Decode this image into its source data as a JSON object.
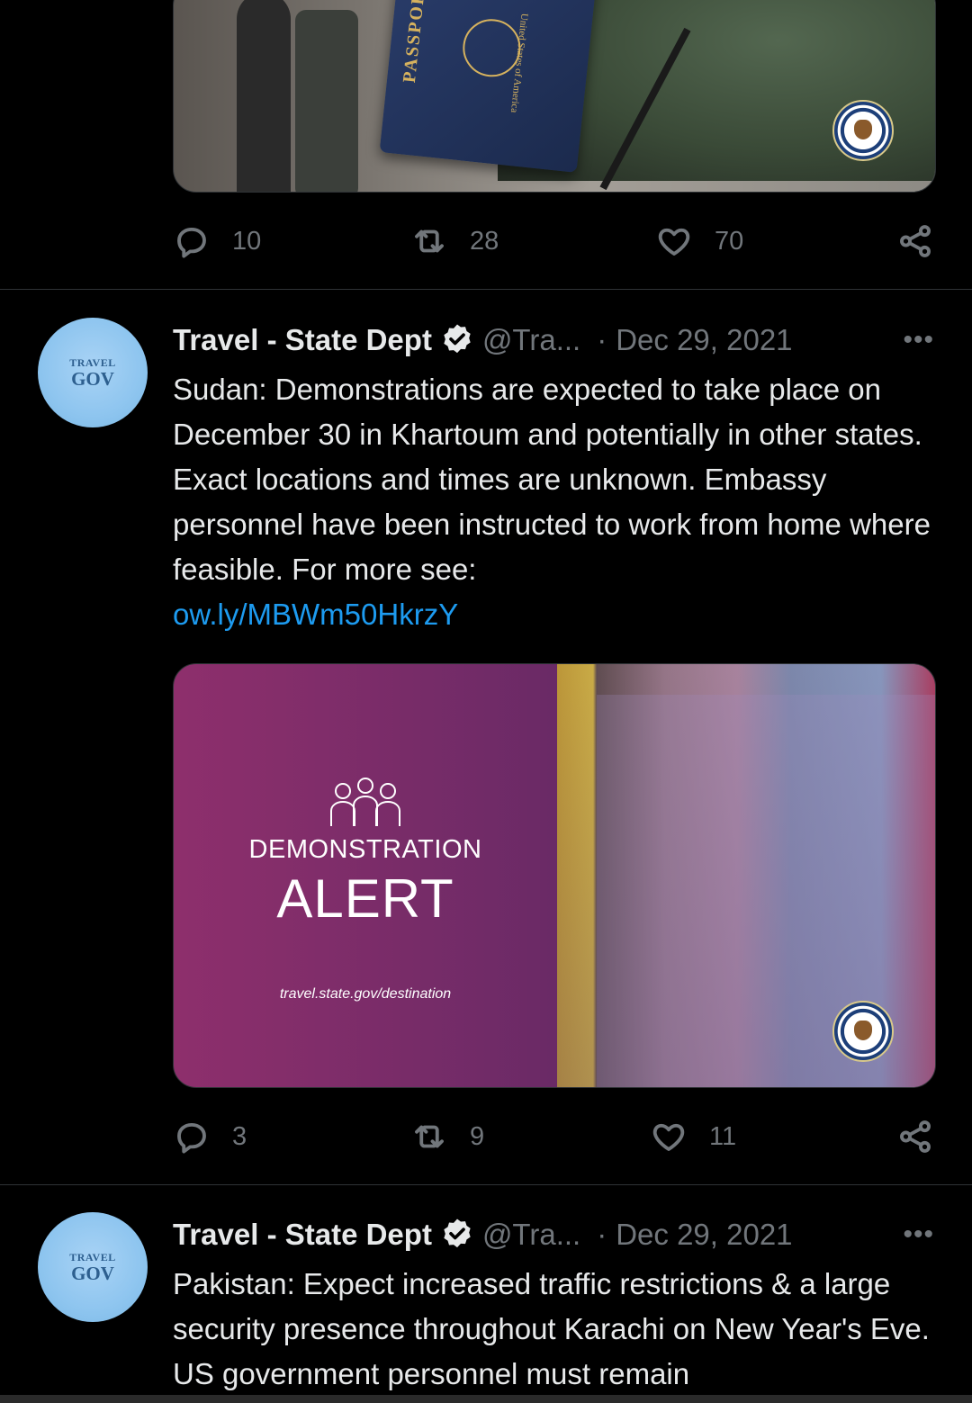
{
  "tweets": [
    {
      "replies": "10",
      "retweets": "28",
      "likes": "70"
    },
    {
      "author": "Travel - State Dept",
      "handle": "@Tra...",
      "separator": "·",
      "date": "Dec 29, 2021",
      "avatar_line1": "TRAVEL",
      "avatar_line2": "GOV",
      "text": "Sudan: Demonstrations are expected to take place on December 30 in Khartoum and potentially in other states.  Exact locations and times are unknown. Embassy personnel have been instructed to work from home where feasible. For more see:",
      "link": "ow.ly/MBWm50HkrzY",
      "image": {
        "line1": "DEMONSTRATION",
        "line2": "ALERT",
        "url": "travel.state.gov/destination"
      },
      "replies": "3",
      "retweets": "9",
      "likes": "11"
    },
    {
      "author": "Travel - State Dept",
      "handle": "@Tra...",
      "separator": "·",
      "date": "Dec 29, 2021",
      "avatar_line1": "TRAVEL",
      "avatar_line2": "GOV",
      "text": "Pakistan: Expect increased traffic restrictions & a large security presence throughout Karachi on New Year's Eve.  US government personnel must remain"
    }
  ],
  "passport": {
    "label": "PASSPORT",
    "country": "United States of America"
  },
  "more_label": "•••",
  "colors": {
    "background": "#000000",
    "text": "#e7e9ea",
    "muted": "#71767b",
    "link": "#1d9bf0",
    "divider": "#2f3336"
  }
}
